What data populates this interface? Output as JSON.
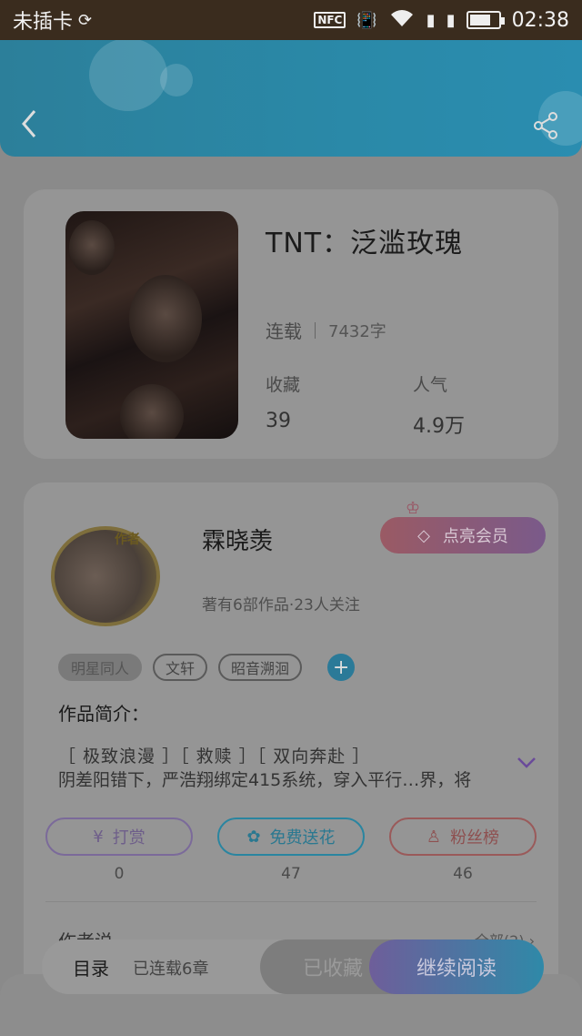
{
  "statusbar": {
    "carrier": "未插卡",
    "time": "02:38",
    "nfc_label": "NFC"
  },
  "header": {
    "back_icon": "chevron-left-icon",
    "share_icon": "share-icon"
  },
  "book": {
    "title": "TNT：泛滥玫瑰",
    "status": "连载",
    "word_count": "7432字",
    "favorites_label": "收藏",
    "favorites_value": "39",
    "popularity_label": "人气",
    "popularity_value": "4.9万"
  },
  "author": {
    "avatar_tag": "作者",
    "name": "霖晓羡",
    "meta": "著有6部作品·23人关注",
    "vip_label": "点亮会员",
    "tags": [
      "明星同人",
      "文轩",
      "昭音溯洄"
    ],
    "add_tag": "+"
  },
  "intro": {
    "title": "作品简介：",
    "keywords": "［ 极致浪漫 ］［ 救赎 ］［ 双向奔赴 ］",
    "text": "阴差阳错下，严浩翔绑定415系统，穿入平行…界，将"
  },
  "actions": {
    "tip_label": "打赏",
    "tip_count": "0",
    "flower_label": "免费送花",
    "flower_count": "47",
    "fans_label": "粉丝榜",
    "fans_count": "46"
  },
  "author_say": {
    "title": "作者说",
    "all_link": "全部(2) ›"
  },
  "bottom": {
    "toc": "目录",
    "chapters": "已连载6章",
    "collected": "已收藏",
    "continue": "继续阅读"
  },
  "colors": {
    "header": "#2a89a8",
    "accent_purple": "#6e5e9a",
    "accent_blue": "#2f89a8",
    "vip_red": "#9a5a64"
  }
}
